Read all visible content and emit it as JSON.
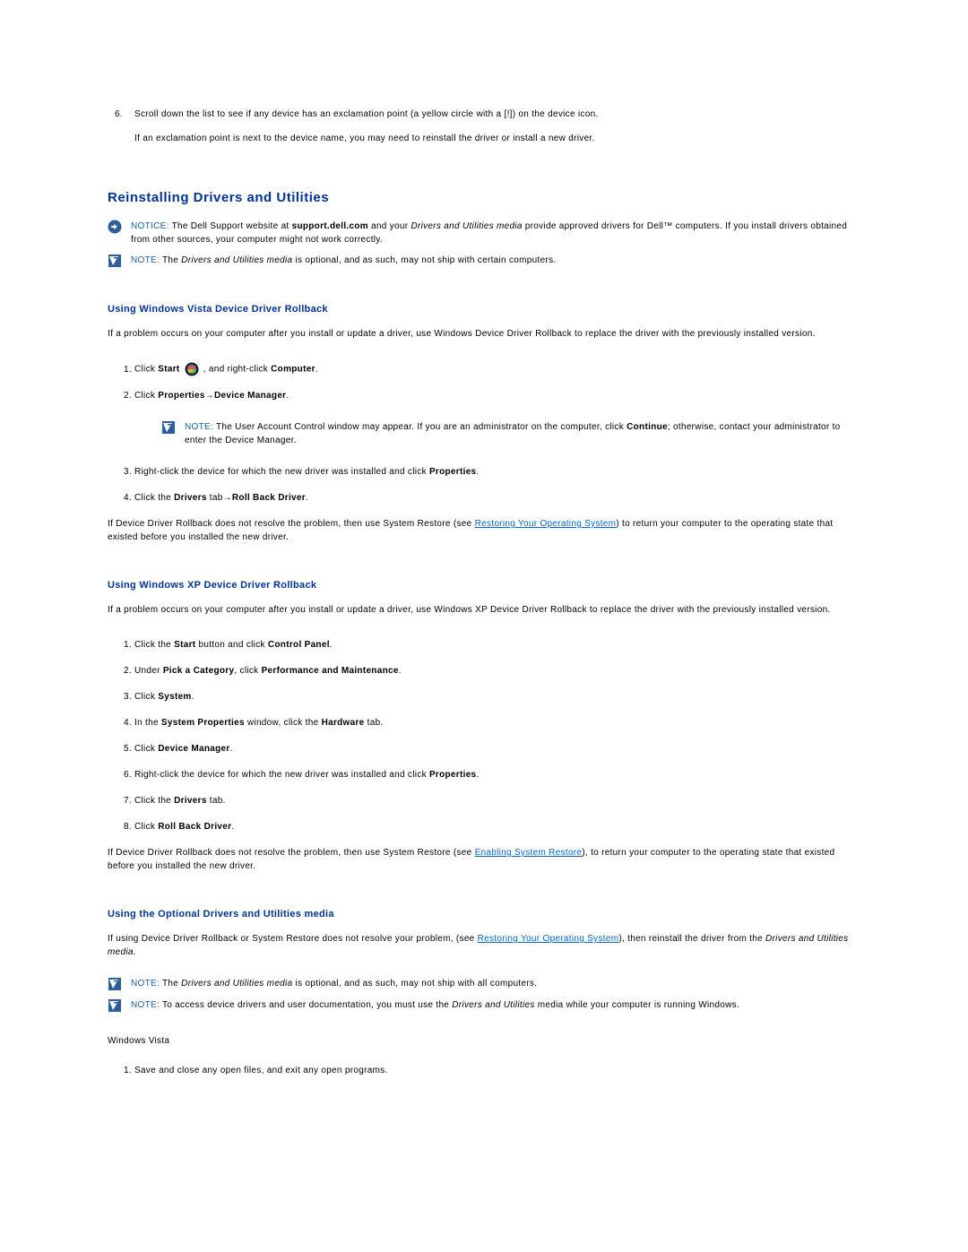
{
  "topList": {
    "item6": "Scroll down the list to see if any device has an exclamation point (a yellow circle with a [!]) on the device icon.",
    "item6followup": "If an exclamation point is next to the device name, you may need to reinstall the driver or install a new driver."
  },
  "heading1": "Reinstalling Drivers and Utilities",
  "notice1": {
    "label": "NOTICE:",
    "pre": " The Dell Support website at ",
    "url": "support.dell.com",
    "mid": " and your ",
    "italic": "Drivers and Utilities media",
    "post": " provide approved drivers for Dell™ computers. If you install drivers obtained from other sources, your computer might not work correctly."
  },
  "note1": {
    "label": "NOTE:",
    "pre": " The ",
    "italic": "Drivers and Utilities media",
    "post": " is optional, and as such, may not ship with certain computers."
  },
  "section_vista": {
    "heading": "Using Windows Vista Device Driver Rollback",
    "intro": "If a problem occurs on your computer after you install or update a driver, use Windows Device Driver Rollback to replace the driver with the previously installed version.",
    "steps": {
      "s1a": "Click ",
      "s1b": "Start",
      "s1c": " , and right-click ",
      "s1d": "Computer",
      "s1e": ".",
      "s2a": "Click ",
      "s2b": "Properties",
      "s2c": "→",
      "s2d": "Device Manager",
      "s2e": ".",
      "note": {
        "label": "NOTE:",
        "pre": " The User Account Control window may appear. If you are an administrator on the computer, click ",
        "bold": "Continue",
        "post": "; otherwise, contact your administrator to enter the Device Manager."
      },
      "s3a": "Right-click the device for which the new driver was installed and click ",
      "s3b": "Properties",
      "s3c": ".",
      "s4a": "Click the ",
      "s4b": "Drivers",
      "s4c": " tab→",
      "s4d": "Roll Back Driver",
      "s4e": "."
    },
    "outro_pre": "If Device Driver Rollback does not resolve the problem, then use System Restore (see ",
    "outro_link": "Restoring Your Operating System",
    "outro_post": ") to return your computer to the operating state that existed before you installed the new driver."
  },
  "section_xp": {
    "heading": "Using Windows XP Device Driver Rollback",
    "intro": "If a problem occurs on your computer after you install or update a driver, use Windows XP Device Driver Rollback to replace the driver with the previously installed version.",
    "steps": {
      "s1a": "Click the ",
      "s1b": "Start",
      "s1c": " button and click ",
      "s1d": "Control Panel",
      "s1e": ".",
      "s2a": "Under ",
      "s2b": "Pick a Category",
      "s2c": ", click ",
      "s2d": "Performance and Maintenance",
      "s2e": ".",
      "s3a": "Click ",
      "s3b": "System",
      "s3c": ".",
      "s4a": "In the ",
      "s4b": "System Properties",
      "s4c": " window, click the ",
      "s4d": "Hardware",
      "s4e": " tab.",
      "s5a": "Click ",
      "s5b": "Device Manager",
      "s5c": ".",
      "s6a": "Right-click the device for which the new driver was installed and click ",
      "s6b": "Properties",
      "s6c": ".",
      "s7a": "Click the ",
      "s7b": "Drivers",
      "s7c": " tab.",
      "s8a": "Click ",
      "s8b": "Roll Back Driver",
      "s8c": "."
    },
    "outro_pre": "If Device Driver Rollback does not resolve the problem, then use System Restore (see ",
    "outro_link": "Enabling System Restore",
    "outro_post": "), to return your computer to the operating state that existed before you installed the new driver."
  },
  "section_media": {
    "heading": "Using the Optional Drivers and Utilities media",
    "intro_pre": "If using Device Driver Rollback or System Restore does not resolve your problem, (see ",
    "intro_link": "Restoring Your Operating System",
    "intro_mid": "), then reinstall the driver from the ",
    "intro_italic": "Drivers and Utilities media.",
    "note1": {
      "label": "NOTE:",
      "pre": " The ",
      "italic": "Drivers and Utilities media",
      "post": " is optional, and as such, may not ship with all computers."
    },
    "note2": {
      "label": "NOTE:",
      "pre": " To access device drivers and user documentation, you must use the ",
      "italic": "Drivers and Utilities",
      "post": " media while your computer is running Windows."
    },
    "subhead": "Windows Vista",
    "steps": {
      "s1": "Save and close any open files, and exit any open programs."
    }
  }
}
